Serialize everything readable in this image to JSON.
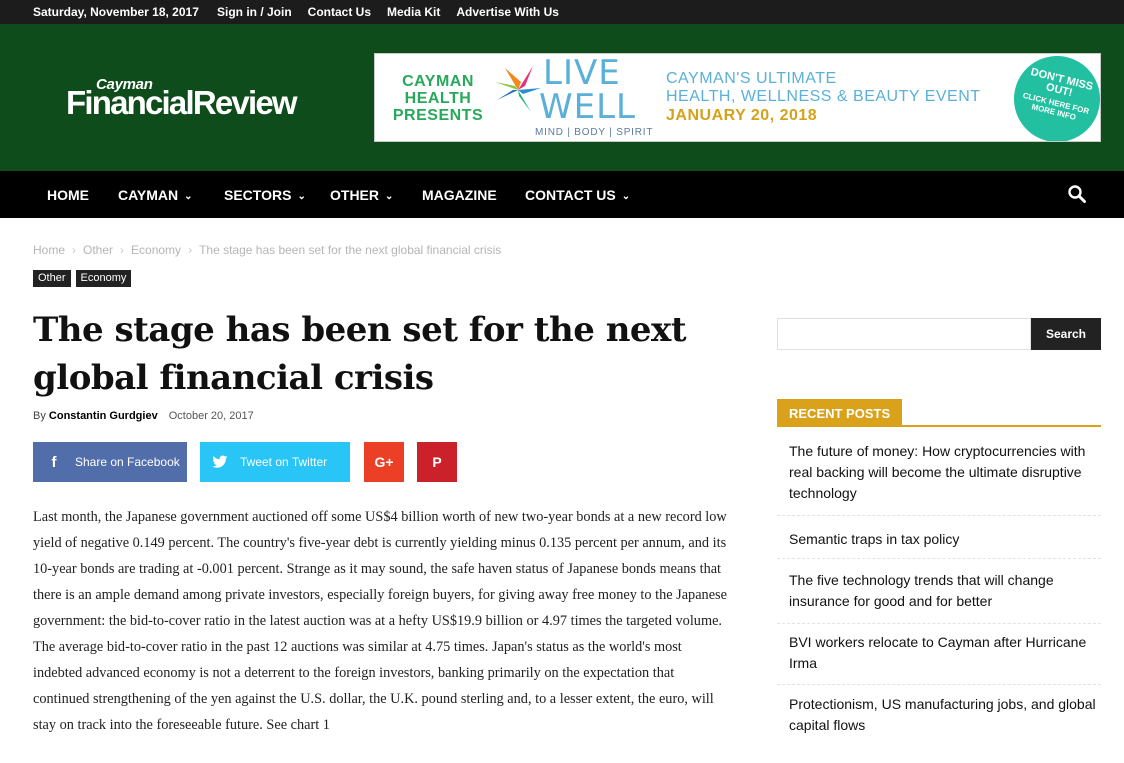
{
  "topbar": {
    "date": "Saturday, November 18, 2017",
    "links": [
      "Sign in / Join",
      "Contact Us",
      "Media Kit",
      "Advertise With Us"
    ]
  },
  "logo": {
    "small": "Cayman",
    "big": "FinancialReview"
  },
  "banner": {
    "presents": [
      "CAYMAN",
      "HEALTH",
      "PRESENTS"
    ],
    "live": "LIVE",
    "well": "WELL",
    "tagline": "MIND | BODY | SPIRIT",
    "ultimate": "CAYMAN'S ULTIMATE",
    "event": "HEALTH, WELLNESS & BEAUTY EVENT",
    "date": "JANUARY 20, 2018",
    "badge_main": "DON'T MISS OUT!",
    "badge_sub": "CLICK HERE FOR MORE INFO"
  },
  "nav": {
    "home": "HOME",
    "cayman": "CAYMAN",
    "sectors": "SECTORS",
    "other": "OTHER",
    "magazine": "MAGAZINE",
    "contact": "CONTACT US"
  },
  "breadcrumb": [
    "Home",
    "Other",
    "Economy",
    "The stage has been set for the next global financial crisis"
  ],
  "tags": [
    "Other",
    "Economy"
  ],
  "article": {
    "title": "The stage has been set for the next global financial crisis",
    "by": "By",
    "author": "Constantin Gurdgiev",
    "date": "October 20, 2017",
    "body": "Last month, the Japanese government auctioned off some US$4 billion worth of new two-year bonds at a new record low yield of negative 0.149 percent. The country's five-year debt is currently yielding minus 0.135 percent per annum, and its 10-year bonds are trading at -0.001 percent. Strange as it may sound, the safe haven status of Japanese bonds means that there is an ample demand among private investors, especially foreign buyers, for giving away free money to the Japanese government: the bid-to-cover ratio in the latest auction was at a hefty US$19.9 billion or 4.97 times the targeted volume. The average bid-to-cover ratio in the past 12 auctions was similar at 4.75 times. Japan's status as the world's most indebted advanced economy is not a deterrent to the foreign investors, banking primarily on the expectation that continued strengthening of the yen against the U.S. dollar, the U.K. pound sterling and, to a lesser extent, the euro, will stay on track into the foreseeable future. See chart 1"
  },
  "share": {
    "facebook": "Share on Facebook",
    "twitter": "Tweet on Twitter",
    "gplus": "G+",
    "pinterest": "P"
  },
  "sidebar": {
    "search_button": "Search",
    "recent_label": "RECENT POSTS",
    "posts": [
      "The future of money: How cryptocurrencies with real backing will become the ultimate disruptive technology",
      "Semantic traps in tax policy",
      "The five technology trends that will change insurance for good and for better",
      "BVI workers relocate to Cayman after Hurricane Irma",
      "Protectionism, US manufacturing jobs, and global capital flows"
    ]
  },
  "colors": {
    "header_green": "#0e4d1b",
    "facebook": "#516eab",
    "twitter": "#29c5f6",
    "gplus": "#eb4026",
    "pinterest": "#ca212a",
    "accent_gold": "#d9a21a"
  },
  "icons": [
    "search-icon",
    "facebook-icon",
    "twitter-icon",
    "chevron-down-icon",
    "flower-logo-icon"
  ]
}
